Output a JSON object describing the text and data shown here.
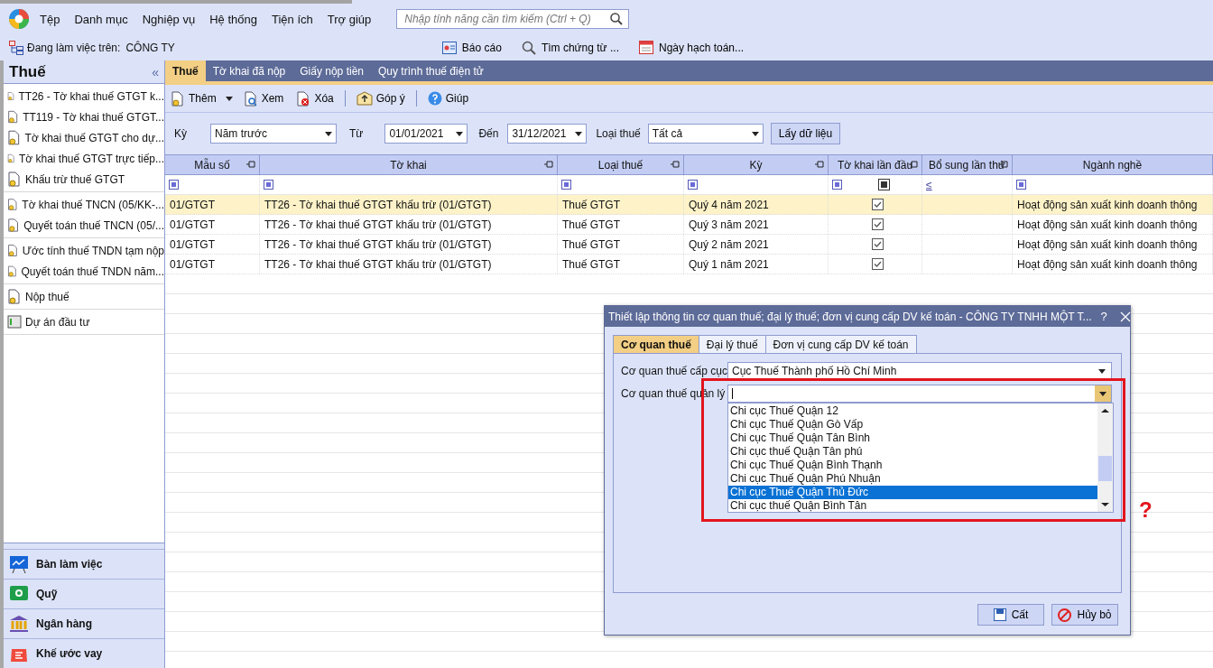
{
  "menu": [
    "Tệp",
    "Danh mục",
    "Nghiệp vụ",
    "Hệ thống",
    "Tiện ích",
    "Trợ giúp"
  ],
  "search": {
    "placeholder": "Nhập tính năng cần tìm kiếm (Ctrl + Q)"
  },
  "workspace": {
    "label": "Đang làm việc trên:",
    "company": "CÔNG TY"
  },
  "quick_actions": [
    {
      "kind": "report",
      "label": "Báo cáo"
    },
    {
      "kind": "search",
      "label": "Tìm chứng từ ..."
    },
    {
      "kind": "calendar",
      "label": "Ngày hạch toán..."
    }
  ],
  "sidebar": {
    "title": "Thuế",
    "collapse": "«",
    "groups": [
      [
        {
          "kind": "form",
          "label": "TT26 - Tờ khai thuế GTGT k..."
        },
        {
          "kind": "form",
          "label": "TT119 - Tờ khai thuế GTGT..."
        },
        {
          "kind": "form",
          "label": "Tờ khai thuế GTGT cho dự..."
        },
        {
          "kind": "form",
          "label": "Tờ khai thuế GTGT trực tiếp..."
        },
        {
          "kind": "form",
          "label": "Khấu trừ thuế GTGT"
        }
      ],
      [
        {
          "kind": "form",
          "label": "Tờ khai thuế TNCN (05/KK-..."
        },
        {
          "kind": "form",
          "label": "Quyết toán thuế TNCN (05/..."
        }
      ],
      [
        {
          "kind": "form",
          "label": "Ước tính thuế TNDN tạm nộp"
        },
        {
          "kind": "form",
          "label": "Quyết toán thuế TNDN năm..."
        }
      ],
      [
        {
          "kind": "form",
          "label": "Nộp thuế"
        }
      ],
      [
        {
          "kind": "project",
          "label": "Dự án đầu tư"
        }
      ]
    ],
    "modules": [
      {
        "kind": "desk",
        "label": "Bàn làm việc"
      },
      {
        "kind": "fund",
        "label": "Quỹ"
      },
      {
        "kind": "bank",
        "label": "Ngân hàng"
      },
      {
        "kind": "loan",
        "label": "Khế ước vay"
      }
    ]
  },
  "tabs": [
    {
      "label": "Thuế",
      "selected": true
    },
    {
      "label": "Tờ khai đã nộp",
      "selected": false
    },
    {
      "label": "Giấy nộp tiền",
      "selected": false
    },
    {
      "label": "Quy trình thuế điện tử",
      "selected": false
    }
  ],
  "toolbar": [
    {
      "kind": "add",
      "label": "Thêm"
    },
    {
      "kind": "view",
      "label": "Xem"
    },
    {
      "kind": "delete",
      "label": "Xóa"
    },
    {
      "kind": "separator"
    },
    {
      "kind": "feedback",
      "label": "Góp ý"
    },
    {
      "kind": "separator"
    },
    {
      "kind": "help",
      "label": "Giúp"
    }
  ],
  "filters": {
    "period_label": "Kỳ",
    "period": "Năm trước",
    "from_label": "Từ",
    "from": "01/01/2021",
    "to_label": "Đến",
    "to": "31/12/2021",
    "type_label": "Loại thuế",
    "type": "Tất cả",
    "fetch": "Lấy dữ liệu"
  },
  "table": {
    "columns": [
      {
        "title": "Mẫu số",
        "pin": true,
        "filter": {
          "kind": "square"
        }
      },
      {
        "title": "Tờ khai",
        "pin": true,
        "filter": {
          "kind": "square"
        }
      },
      {
        "title": "Loại thuế",
        "pin": true,
        "filter": {
          "kind": "square"
        }
      },
      {
        "title": "Kỳ",
        "pin": true,
        "filter": {
          "kind": "square"
        }
      },
      {
        "title": "Tờ khai lần đầu",
        "pin": true,
        "filter": {
          "kind": "checkbox"
        }
      },
      {
        "title": "Bổ sung lần thứ",
        "pin": true,
        "filter": {
          "kind": "operator",
          "text": "≤"
        }
      },
      {
        "title": "Ngành nghề",
        "pin": false,
        "filter": {
          "kind": "square"
        }
      }
    ],
    "rows": [
      {
        "selected": true,
        "form_no": "01/GTGT",
        "form": "TT26 - Tờ khai thuế GTGT khấu trừ (01/GTGT)",
        "tax_type": "Thuế GTGT",
        "period": "Quý 4 năm 2021",
        "first_filing": true,
        "industry": "Hoạt động sản xuất kinh doanh thông"
      },
      {
        "selected": false,
        "form_no": "01/GTGT",
        "form": "TT26 - Tờ khai thuế GTGT khấu trừ (01/GTGT)",
        "tax_type": "Thuế GTGT",
        "period": "Quý 3 năm 2021",
        "first_filing": true,
        "industry": "Hoạt động sản xuất kinh doanh thông"
      },
      {
        "selected": false,
        "form_no": "01/GTGT",
        "form": "TT26 - Tờ khai thuế GTGT khấu trừ (01/GTGT)",
        "tax_type": "Thuế GTGT",
        "period": "Quý 2 năm 2021",
        "first_filing": true,
        "industry": "Hoạt động sản xuất kinh doanh thông"
      },
      {
        "selected": false,
        "form_no": "01/GTGT",
        "form": "TT26 - Tờ khai thuế GTGT khấu trừ (01/GTGT)",
        "tax_type": "Thuế GTGT",
        "period": "Quý 1 năm 2021",
        "first_filing": true,
        "industry": "Hoạt động sản xuất kinh doanh thông"
      }
    ]
  },
  "dialog": {
    "title": "Thiết lập thông tin cơ quan thuế; đại lý thuế; đơn vị cung cấp DV kế toán - CÔNG TY TNHH MỘT T...",
    "help": "?",
    "tabs": [
      {
        "label": "Cơ quan thuế",
        "selected": true
      },
      {
        "label": "Đại lý thuế",
        "selected": false
      },
      {
        "label": "Đơn vị cung cấp DV kế toán",
        "selected": false
      }
    ],
    "department": {
      "label": "Cơ quan thuế cấp cục",
      "value": "Cục Thuế Thành phố Hồ Chí Minh"
    },
    "office": {
      "label": "Cơ quan thuế quản lý",
      "expanded": true,
      "options": [
        {
          "label": "Chi cục Thuế Quận 12",
          "selected": false
        },
        {
          "label": "Chi cục Thuế Quận Gò Vấp",
          "selected": false
        },
        {
          "label": "Chi cục Thuế Quận Tân Bình",
          "selected": false
        },
        {
          "label": "Chi cục thuế Quận Tân phú",
          "selected": false
        },
        {
          "label": "Chi cục Thuế Quận Bình Thạnh",
          "selected": false
        },
        {
          "label": "Chi cục Thuế Quận Phú Nhuận",
          "selected": false
        },
        {
          "label": "Chi cục Thuế Quận Thủ Đức",
          "selected": true
        },
        {
          "label": "Chi cục thuế Quận Bình Tân",
          "selected": false
        }
      ]
    },
    "buttons": [
      {
        "kind": "save",
        "label": "Cất"
      },
      {
        "kind": "cancel",
        "label": "Hủy bỏ"
      }
    ]
  },
  "annotation": {
    "mark": "?"
  }
}
